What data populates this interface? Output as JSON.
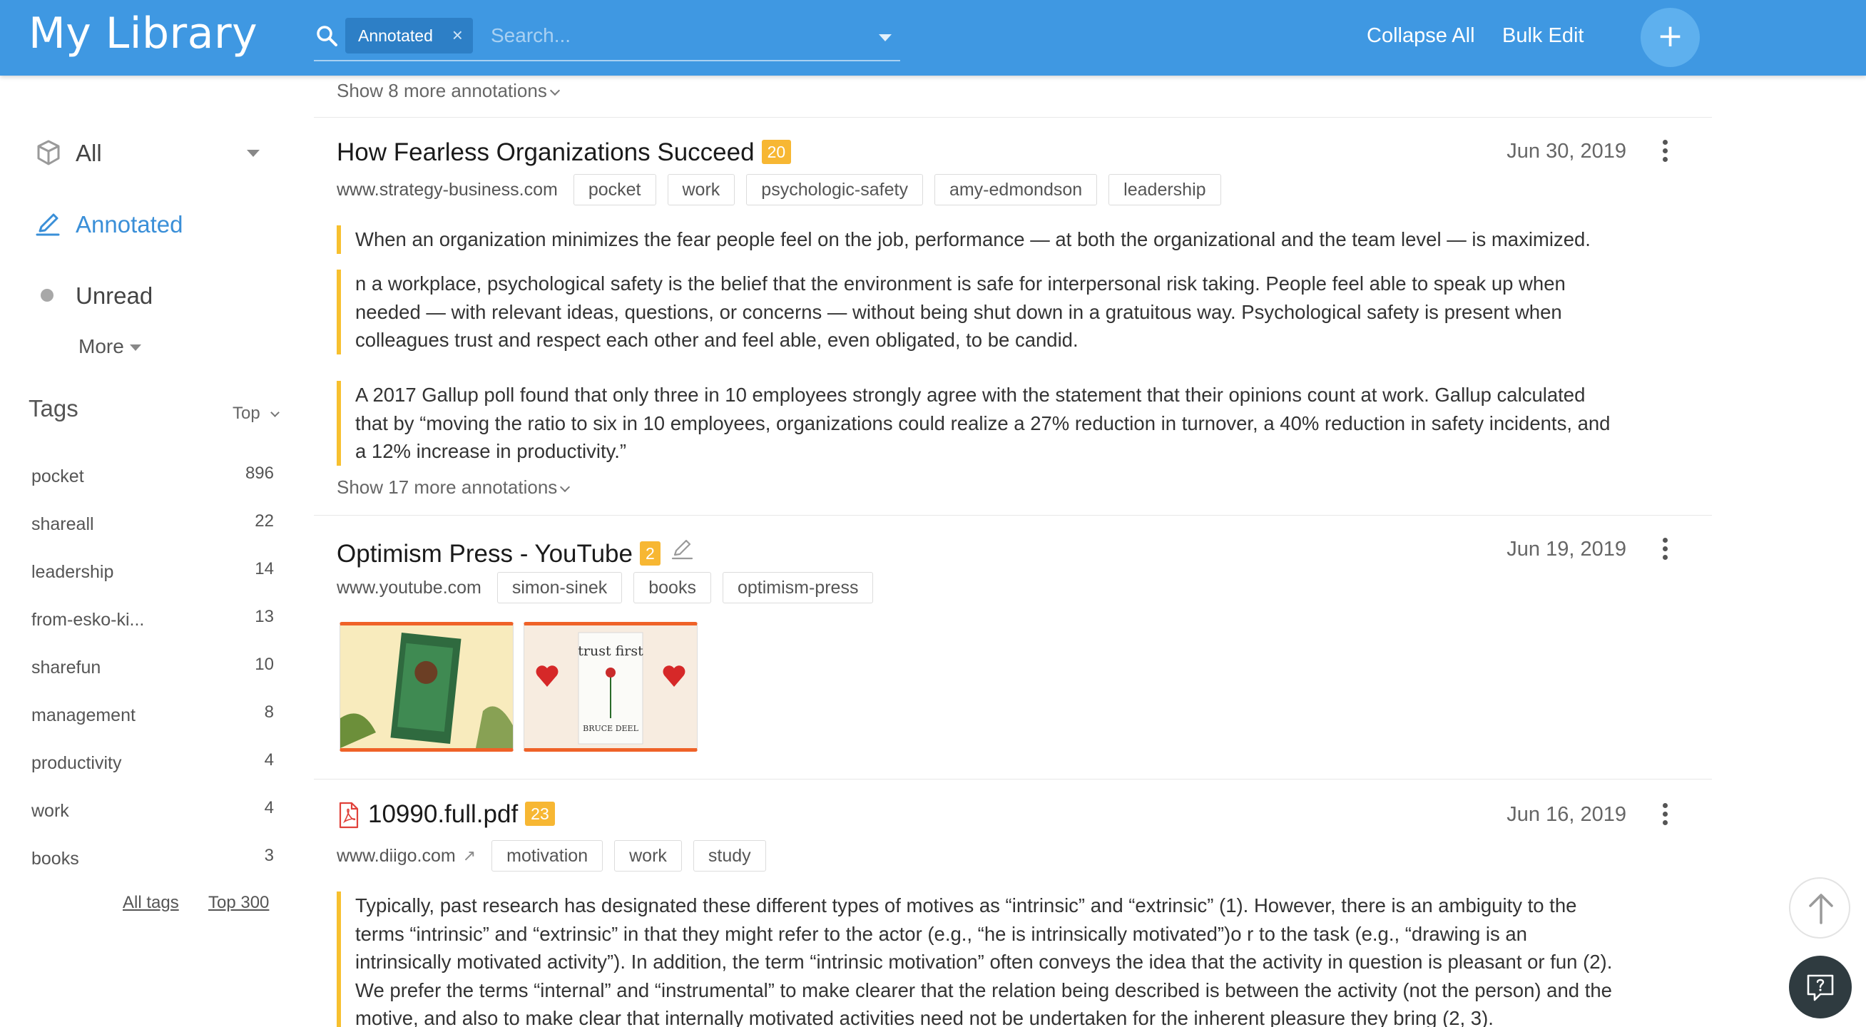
{
  "header": {
    "title": "My Library",
    "filter_chip": "Annotated",
    "filter_chip_close": "×",
    "search_placeholder": "Search...",
    "collapse_all": "Collapse All",
    "bulk_edit": "Bulk Edit",
    "add_label": "+"
  },
  "sidebar": {
    "nav": [
      {
        "label": "All",
        "icon": "cube-icon"
      },
      {
        "label": "Annotated",
        "icon": "pencil-icon",
        "active": true
      },
      {
        "label": "Unread",
        "icon": "dot-icon"
      }
    ],
    "more": "More",
    "tags_heading": "Tags",
    "tags_sort": "Top",
    "tags": [
      {
        "name": "pocket",
        "count": "896"
      },
      {
        "name": "shareall",
        "count": "22"
      },
      {
        "name": "leadership",
        "count": "14"
      },
      {
        "name": "from-esko-ki...",
        "count": "13"
      },
      {
        "name": "sharefun",
        "count": "10"
      },
      {
        "name": "management",
        "count": "8"
      },
      {
        "name": "productivity",
        "count": "4"
      },
      {
        "name": "work",
        "count": "4"
      },
      {
        "name": "books",
        "count": "3"
      }
    ],
    "all_tags": "All tags",
    "top_300": "Top 300"
  },
  "items": [
    {
      "show_more": "Show 8 more annotations"
    },
    {
      "title": "How Fearless Organizations Succeed",
      "badge": "20",
      "date": "Jun 30, 2019",
      "domain": "www.strategy-business.com",
      "tags": [
        "pocket",
        "work",
        "psychologic-safety",
        "amy-edmondson",
        "leadership"
      ],
      "annotations": [
        "When an organization minimizes the fear people feel on the job, performance — at both the organizational and the team level — is maximized.",
        "n a workplace, psychological safety is the belief that the environment is safe for interpersonal risk taking. People feel able to speak up when needed — with relevant ideas, questions, or concerns — without being shut down in a gratuitous way. Psychological safety is present when colleagues trust and respect each other and feel able, even obligated, to be candid.",
        "A 2017 Gallup poll found that only three in 10 employees strongly agree with the statement that their opinions count at work. Gallup calculated that by “moving the ratio to six in 10 employees, organizations could realize a 27% reduction in turnover, a 40% reduction in safety incidents, and a 12% increase in productivity.”"
      ],
      "show_more": "Show 17 more annotations"
    },
    {
      "title": "Optimism Press - YouTube",
      "badge": "2",
      "date": "Jun 19, 2019",
      "domain": "www.youtube.com",
      "tags": [
        "simon-sinek",
        "books",
        "optimism-press"
      ],
      "thumb_2_text": "trust first",
      "thumb_2_author": "BRUCE DEEL"
    },
    {
      "title": "10990.full.pdf",
      "badge": "23",
      "date": "Jun 16, 2019",
      "domain": "www.diigo.com",
      "external_icon": "↗",
      "tags": [
        "motivation",
        "work",
        "study"
      ],
      "annotations": [
        "Typically, past research has designated these different types of motives as “intrinsic” and “extrinsic” (1). However, there is an ambiguity to the terms “intrinsic” and “extrinsic” in that they might refer to the actor (e.g., “he is intrinsically motivated”)o r to the task (e.g., “drawing is an intrinsically motivated activity”). In addition, the term “intrinsic motivation” often conveys the idea that the activity in question is pleasant or fun (2). We prefer the terms “internal” and “instrumental” to make clearer that the relation being described is between the activity (not the person) and the motive, and also to make clear that internally motivated activities need not be undertaken for the inherent pleasure they bring (2, 3)."
      ]
    }
  ],
  "colors": {
    "header": "#3f98e2",
    "accent": "#3a8fd8",
    "badge": "#f7b733",
    "highlight_bar": "#f7c02f"
  }
}
